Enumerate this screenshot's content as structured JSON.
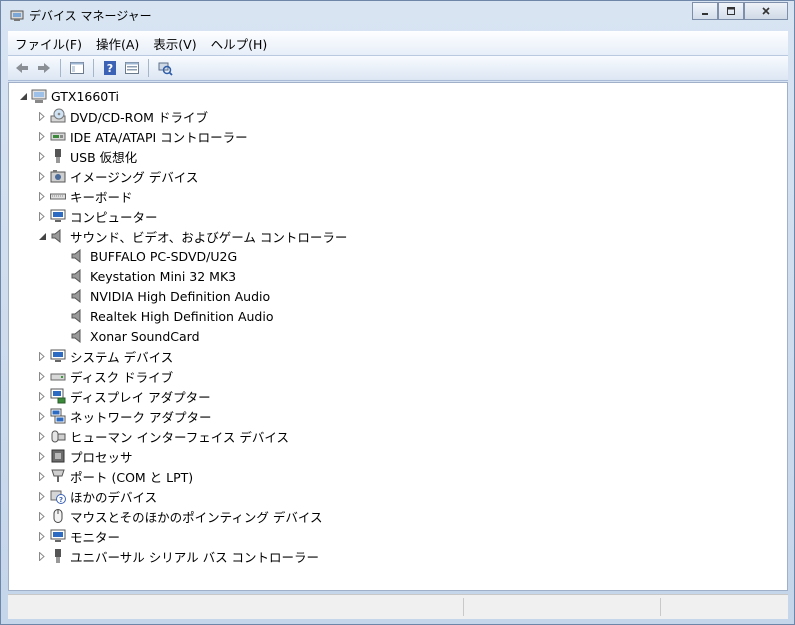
{
  "window": {
    "title": "デバイス マネージャー"
  },
  "menu": [
    "ファイル(F)",
    "操作(A)",
    "表示(V)",
    "ヘルプ(H)"
  ],
  "toolbar": {
    "icons": [
      "back-arrow-icon",
      "forward-arrow-icon",
      "properties-pane-icon",
      "help-icon",
      "device-view-icon",
      "scan-hardware-icon"
    ]
  },
  "tree": {
    "root": {
      "label": "GTX1660Ti"
    },
    "categories": [
      {
        "label": "DVD/CD-ROM ドライブ",
        "icon": "optical-drive-icon"
      },
      {
        "label": "IDE ATA/ATAPI コントローラー",
        "icon": "ide-controller-icon"
      },
      {
        "label": "USB 仮想化",
        "icon": "usb-icon"
      },
      {
        "label": "イメージング デバイス",
        "icon": "camera-icon"
      },
      {
        "label": "キーボード",
        "icon": "keyboard-icon"
      },
      {
        "label": "コンピューター",
        "icon": "computer-icon"
      },
      {
        "label": "サウンド、ビデオ、およびゲーム コントローラー",
        "icon": "speaker-icon",
        "expanded": true,
        "children": [
          "BUFFALO PC-SDVD/U2G",
          "Keystation Mini 32 MK3",
          "NVIDIA High Definition Audio",
          "Realtek High Definition Audio",
          "Xonar SoundCard"
        ]
      },
      {
        "label": "システム デバイス",
        "icon": "system-device-icon"
      },
      {
        "label": "ディスク ドライブ",
        "icon": "disk-drive-icon"
      },
      {
        "label": "ディスプレイ アダプター",
        "icon": "display-adapter-icon"
      },
      {
        "label": "ネットワーク アダプター",
        "icon": "network-adapter-icon"
      },
      {
        "label": "ヒューマン インターフェイス デバイス",
        "icon": "hid-icon"
      },
      {
        "label": "プロセッサ",
        "icon": "processor-icon"
      },
      {
        "label": "ポート (COM と LPT)",
        "icon": "port-icon"
      },
      {
        "label": "ほかのデバイス",
        "icon": "unknown-device-icon"
      },
      {
        "label": "マウスとそのほかのポインティング デバイス",
        "icon": "mouse-icon"
      },
      {
        "label": "モニター",
        "icon": "monitor-icon"
      },
      {
        "label": "ユニバーサル シリアル バス コントローラー",
        "icon": "usb-controller-icon"
      }
    ]
  }
}
